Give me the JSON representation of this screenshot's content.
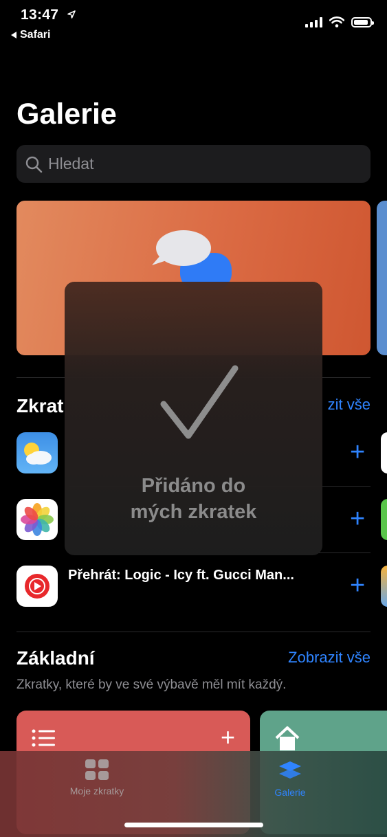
{
  "status": {
    "time": "13:47",
    "back_label": "Safari"
  },
  "page": {
    "title": "Galerie"
  },
  "search": {
    "placeholder": "Hledat"
  },
  "shortcuts_section": {
    "title_visible": "Zkrat",
    "see_all_visible": "zit vše",
    "items": [
      {
        "icon": "weather-icon",
        "label": ""
      },
      {
        "icon": "photos-icon",
        "label": ""
      },
      {
        "icon": "youtube-music-icon",
        "label": "Přehrát: Logic - Icy ft. Gucci Man..."
      }
    ]
  },
  "basic_section": {
    "title": "Základní",
    "see_all": "Zobrazit vše",
    "subtitle": "Zkratky, které by ve své výbavě měl mít každý."
  },
  "hud": {
    "line1": "Přidáno do",
    "line2": "mých zkratek"
  },
  "tabbar": {
    "tabs": [
      {
        "label": "Moje zkratky",
        "active": false
      },
      {
        "label": "Galerie",
        "active": true
      }
    ]
  },
  "colors": {
    "accent": "#2f84ff",
    "hero_card": "#db6b44",
    "card_red": "#d85a57",
    "card_green": "#5fa38a"
  }
}
